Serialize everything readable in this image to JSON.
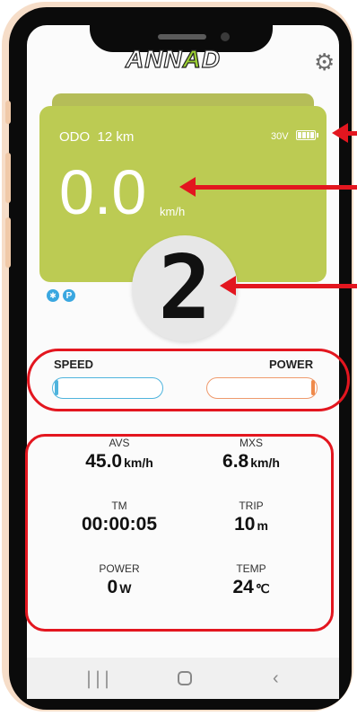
{
  "header": {
    "logo_text_1": "ANN",
    "logo_text_a": "A",
    "logo_text_2": "D"
  },
  "dashboard": {
    "odo_label": "ODO",
    "odo_value": "12 km",
    "battery_voltage": "30V",
    "speed_value": "0.0",
    "speed_unit": "km/h",
    "gear_level": "2",
    "bluetooth_icon": "bluetooth-icon",
    "parking_icon": "P"
  },
  "bars": {
    "speed_label": "SPEED",
    "power_label": "POWER",
    "speed_level": 0,
    "power_level": 0
  },
  "stats": {
    "avs_label": "AVS",
    "avs_value": "45.0",
    "avs_unit": "km/h",
    "mxs_label": "MXS",
    "mxs_value": "6.8",
    "mxs_unit": "km/h",
    "tm_label": "TM",
    "tm_value": "00:00:05",
    "trip_label": "TRIP",
    "trip_value": "10",
    "trip_unit": "m",
    "power_label": "POWER",
    "power_value": "0",
    "power_unit": "W",
    "temp_label": "TEMP",
    "temp_value": "24",
    "temp_unit": "℃"
  },
  "colors": {
    "card": "#bccb53",
    "annotation": "#e3161f",
    "speed_bar": "#4fb4dd",
    "power_bar": "#ef9a6d"
  }
}
